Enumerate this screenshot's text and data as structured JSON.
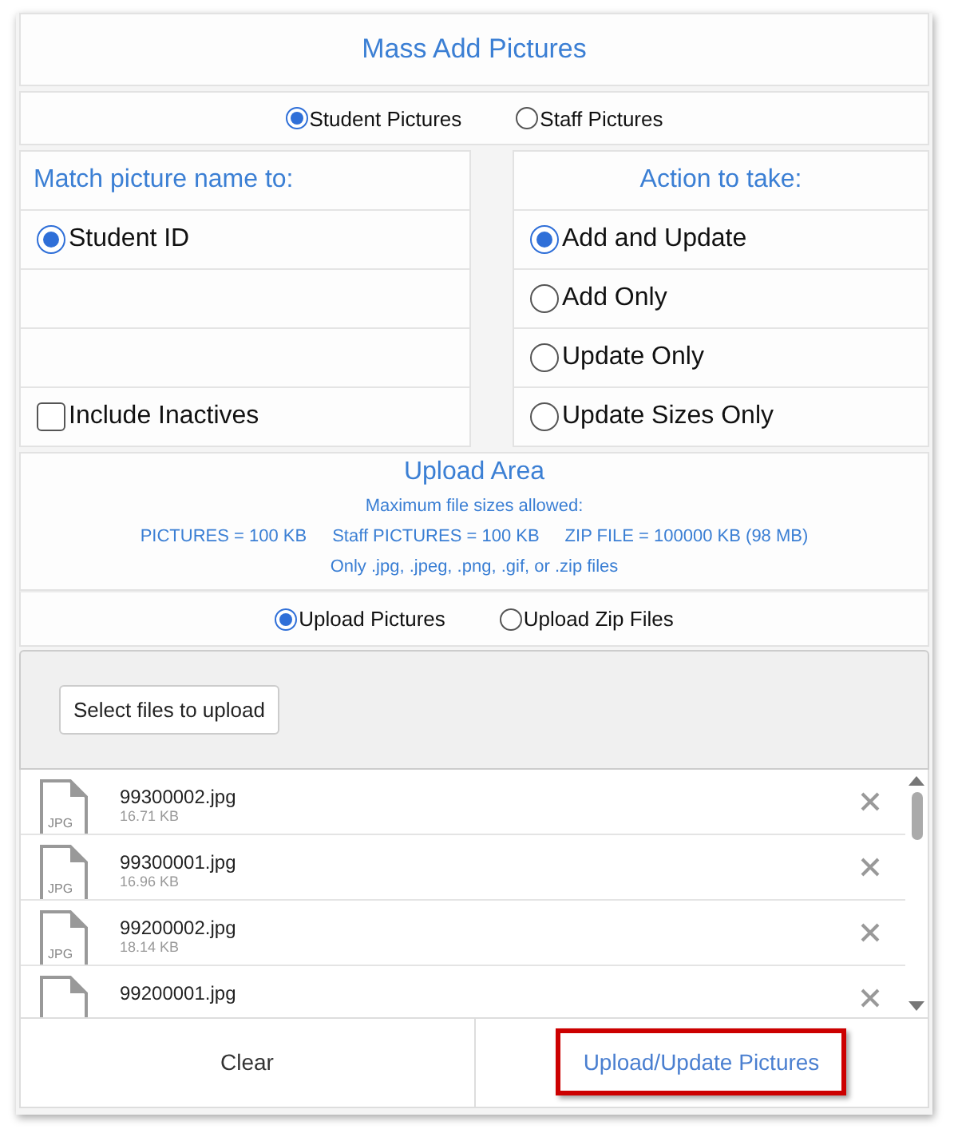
{
  "title": "Mass Add Pictures",
  "picture_type": [
    {
      "label": "Student Pictures",
      "selected": true
    },
    {
      "label": "Staff Pictures",
      "selected": false
    }
  ],
  "match": {
    "heading": "Match picture name to:",
    "options": [
      {
        "label": "Student ID",
        "selected": true
      }
    ],
    "include_inactives": {
      "label": "Include Inactives",
      "checked": false
    }
  },
  "action": {
    "heading": "Action to take:",
    "options": [
      {
        "label": "Add and Update",
        "selected": true
      },
      {
        "label": "Add Only",
        "selected": false
      },
      {
        "label": "Update Only",
        "selected": false
      },
      {
        "label": "Update Sizes Only",
        "selected": false
      }
    ]
  },
  "upload_area": {
    "heading": "Upload Area",
    "subheading": "Maximum file sizes allowed:",
    "limits": [
      "PICTURES = 100 KB",
      "Staff PICTURES = 100 KB",
      "ZIP FILE = 100000 KB (98 MB)"
    ],
    "note": "Only .jpg, .jpeg, .png, .gif, or .zip files"
  },
  "upload_mode": [
    {
      "label": "Upload Pictures",
      "selected": true
    },
    {
      "label": "Upload Zip Files",
      "selected": false
    }
  ],
  "select_button": "Select files to upload",
  "files": [
    {
      "name": "99300002.jpg",
      "size": "16.71 KB",
      "icon_label": "JPG"
    },
    {
      "name": "99300001.jpg",
      "size": "16.96 KB",
      "icon_label": "JPG"
    },
    {
      "name": "99200002.jpg",
      "size": "18.14 KB",
      "icon_label": "JPG"
    },
    {
      "name": "99200001.jpg"
    }
  ],
  "footer": {
    "clear": "Clear",
    "upload": {
      "label": "Upload/Update Pictures",
      "highlighted": true
    }
  }
}
